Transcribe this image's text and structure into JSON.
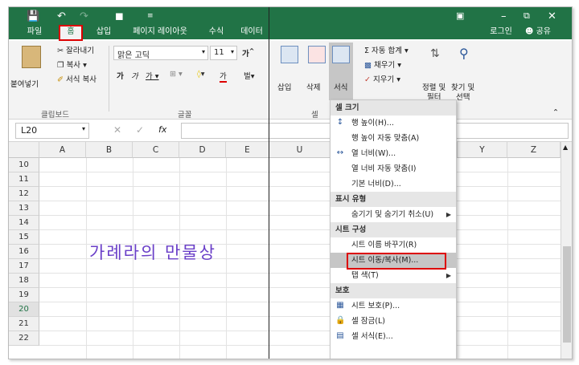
{
  "titlebar": {
    "tabs": [
      "파일",
      "홈",
      "삽입",
      "페이지 레이아웃",
      "수식",
      "데이터"
    ],
    "login": "로그인",
    "share": "공유"
  },
  "ribbon": {
    "clipboard": {
      "paste": "붙여넣기",
      "cut": "잘라내기",
      "copy": "복사",
      "format_painter": "서식 복사",
      "group": "클립보드"
    },
    "font": {
      "name": "맑은 고딕",
      "size": "11",
      "group": "글꼴"
    },
    "cells": {
      "insert": "삽입",
      "delete": "삭제",
      "format": "서식",
      "group": "셀"
    },
    "editing": {
      "autosum": "자동 합계",
      "fill": "채우기",
      "clear": "지우기",
      "sort": "정렬 및",
      "sort2": "필터",
      "find": "찾기 및",
      "find2": "선택"
    }
  },
  "formula": {
    "namebox": "L20",
    "fx": "fx"
  },
  "columns_left": [
    "A",
    "B",
    "C",
    "D",
    "E"
  ],
  "columns_right": [
    "U",
    "Y",
    "Z"
  ],
  "rows": [
    "10",
    "11",
    "12",
    "13",
    "14",
    "15",
    "16",
    "17",
    "18",
    "19",
    "20",
    "21",
    "22"
  ],
  "watermark": "가례라의 만물상",
  "menu": {
    "sections": [
      {
        "header": "셀 크기",
        "items": [
          {
            "label": "행 높이(H)...",
            "icon": "row-height-icon"
          },
          {
            "label": "행 높이 자동 맞춤(A)",
            "icon": ""
          },
          {
            "label": "열 너비(W)...",
            "icon": "column-width-icon"
          },
          {
            "label": "열 너비 자동 맞춤(I)",
            "icon": ""
          },
          {
            "label": "기본 너비(D)...",
            "icon": ""
          }
        ]
      },
      {
        "header": "표시 유형",
        "items": [
          {
            "label": "숨기기 및 숨기기 취소(U)",
            "icon": "",
            "submenu": true
          }
        ]
      },
      {
        "header": "시트 구성",
        "items": [
          {
            "label": "시트 이름 바꾸기(R)",
            "icon": ""
          },
          {
            "label": "시트 이동/복사(M)...",
            "icon": "",
            "highlight": true
          },
          {
            "label": "탭 색(T)",
            "icon": "",
            "submenu": true
          }
        ]
      },
      {
        "header": "보호",
        "items": [
          {
            "label": "시트 보호(P)...",
            "icon": "protect-sheet-icon"
          },
          {
            "label": "셀 잠금(L)",
            "icon": "lock-icon"
          },
          {
            "label": "셀 서식(E)...",
            "icon": "format-cells-icon"
          }
        ]
      }
    ]
  }
}
